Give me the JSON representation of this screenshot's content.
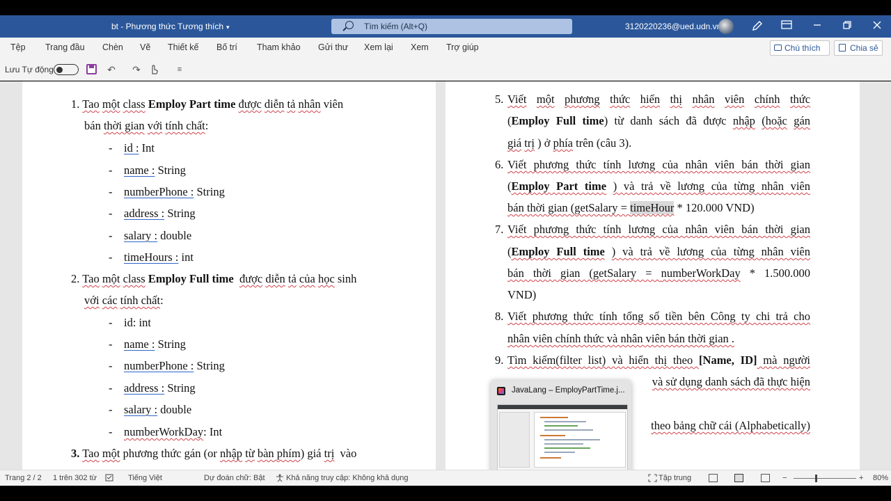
{
  "titlebar": {
    "doc_name": "bt  -  Phương thức Tương thích",
    "caret": "▾",
    "search_placeholder": "Tìm kiếm (Alt+Q)",
    "account": "3120220236@ued.udn.vn",
    "icons": [
      "pen-icon",
      "ribbon-display-icon",
      "minimize-icon",
      "restore-icon",
      "close-icon"
    ],
    "accent": "#2b579a"
  },
  "menu": {
    "tabs": [
      "Tệp",
      "Trang đầu",
      "Chèn",
      "Vẽ",
      "Thiết kế",
      "Bố trí",
      "Tham khảo",
      "Gửi thư",
      "Xem lại",
      "Xem",
      "Trợ giúp"
    ],
    "comment_label": "Chú thích",
    "share_label": "Chia sẻ"
  },
  "qat": {
    "autosave_label": "Lưu Tự động",
    "undo": "↶",
    "redo": "↷",
    "more": "≡"
  },
  "left_page": {
    "l1_num": "1.",
    "l1_a": "Tao",
    "l1_b": "một",
    "l1_c": "class",
    "l1_d": "Employ Part time",
    "l1_e": "được",
    "l1_f": "diễn",
    "l1_g": "tả",
    "l1_h": "nhân",
    "l1_i": "viên",
    "l2": [
      "bán",
      "thời gian",
      "với",
      "tính chất",
      ":"
    ],
    "c1_fields": [
      {
        "name": "id :",
        "type": " Int"
      },
      {
        "name": "name :",
        "type": " String"
      },
      {
        "name": "numberPhone :",
        "type": " String"
      },
      {
        "name": "address :",
        "type": " String"
      },
      {
        "name": "salary :",
        "type": " double"
      },
      {
        "name": "timeHours :",
        "type": " int"
      }
    ],
    "l2_num": "2.",
    "l2_a": "Tao",
    "l2_b": "một",
    "l2_c": "class",
    "l2_d": "Employ Full time",
    "l2_e": "được",
    "l2_f": "diễn",
    "l2_g": "tả",
    "l2_h": "của",
    "l2_i": "học",
    "l2_j": "sinh",
    "l2b": [
      "với",
      "các",
      "tính chất",
      ":"
    ],
    "c2_first": "id: int",
    "c2_fields": [
      {
        "name": "name :",
        "type": " String"
      },
      {
        "name": "numberPhone :",
        "type": " String"
      },
      {
        "name": "address :",
        "type": " String"
      },
      {
        "name": "salary :",
        "type": " double"
      },
      {
        "name": "numberWorkDay",
        "type": ": Int"
      }
    ],
    "l3_num": "3.",
    "l3_a": "Tao",
    "l3_b": "một",
    "l3_c": "phương thức gán (or",
    "l3_d": "nhập",
    "l3_e": "từ",
    "l3_f": "bàn phím",
    "l3_g": ") giá",
    "l3_h": "trị",
    "l3_i": "vào",
    "dash": "-"
  },
  "right_page": {
    "i5_num": "5.",
    "i5_l1": [
      "Viết",
      "một",
      "phương",
      "thức",
      "hiển",
      "thị",
      "nhân",
      "viên",
      "chính",
      "thức"
    ],
    "i5_l2a": "(",
    "i5_l2b": "Employ Full time",
    "i5_l2c": ") từ danh sách đã được",
    "i5_l2d": "nhập",
    "i5_l2e": "(hoặc",
    "i5_l2f": "gán",
    "i5_l3a": "giá",
    "i5_l3b": "trị",
    "i5_l3c": ") ở",
    "i5_l3d": "phía",
    "i5_l3e": "trên (câu 3).",
    "i6_num": "6.",
    "i6_l1": "Viết phương thức tính lương của nhân viên bán thời gian",
    "i6_l2a": "(",
    "i6_l2b": "Employ Part time",
    "i6_l2c": ") và trả về lương của từng nhân viên",
    "i6_l3a": "bán thời gian  (getSalary = ",
    "i6_l3b": "timeHour",
    "i6_l3c": " * 120.000 VND)",
    "i7_num": "7.",
    "i7_l1": "Viết phương thức tính lương của nhân viên bán thời gian",
    "i7_l2a": "(",
    "i7_l2b": "Employ Full time",
    "i7_l2c": " ) và trả về lương của từng nhân viên",
    "i7_l3a": "bán thời gian  (getSalary = ",
    "i7_l3b": "numberWorkDay",
    "i7_l3c": " * 1.500.000",
    "i7_l4": "VND)",
    "i8_num": "8.",
    "i8_l1": "Viết phương thức tính tổng số tiền bên Công ty chi trả cho",
    "i8_l2": "nhân viên chính thức và nhân viên bán thời gian .",
    "i9_num": "9.",
    "i9_l1a": "Tìm kiếm(filter list) và hiển thị theo ",
    "i9_l1b": "[Name, ID]",
    "i9_l1c": " mà người",
    "i9_l2": "và sử dụng danh sách đã thực hiện",
    "i10_l1": "theo bảng chữ cái (Alphabetically)"
  },
  "thumbnail": {
    "title": "JavaLang – EmployPartTime.j..."
  },
  "status": {
    "page": "Trang 2 / 2",
    "words": "1 trên 302 từ",
    "language": "Tiếng Việt",
    "predict": "Dự đoán chữ: Bật",
    "access": "Khả năng truy cập: Không khả dụng",
    "focus": "Tập trung",
    "zoom_minus": "−",
    "zoom_plus": "+",
    "zoom": "80%"
  }
}
